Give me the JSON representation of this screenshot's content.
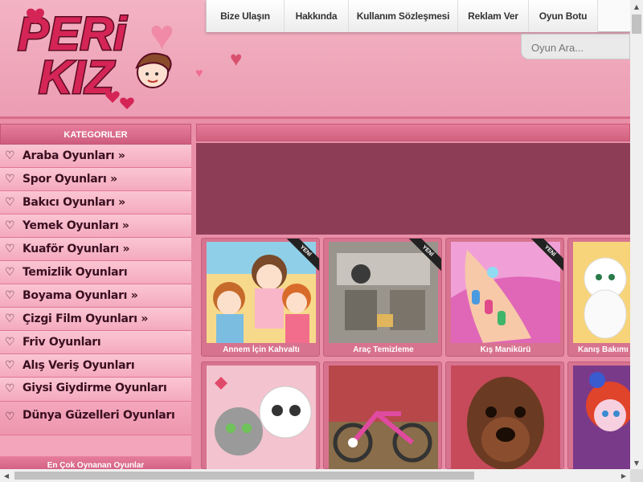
{
  "logo": {
    "line1": "PERi",
    "line2": "KIZ"
  },
  "nav": {
    "items": [
      "Bize Ulaşın",
      "Hakkında",
      "Kullanım Sözleşmesi",
      "Reklam Ver",
      "Oyun Botu"
    ]
  },
  "search": {
    "placeholder": "Oyun Ara..."
  },
  "sidebar": {
    "title": "KATEGORILER",
    "items": [
      {
        "label": "Araba Oyunları »"
      },
      {
        "label": "Spor Oyunları »"
      },
      {
        "label": "Bakıcı Oyunları »"
      },
      {
        "label": "Yemek Oyunları »"
      },
      {
        "label": "Kuaför Oyunları »"
      },
      {
        "label": "Temizlik Oyunları"
      },
      {
        "label": "Boyama Oyunları »"
      },
      {
        "label": "Çizgi Film Oyunları »"
      },
      {
        "label": "Friv Oyunları"
      },
      {
        "label": "Alış Veriş Oyunları"
      },
      {
        "label": "Giysi Giydirme Oyunları"
      },
      {
        "label": "Dünya Güzelleri Oyunları"
      }
    ],
    "footer": "En Çok Oynanan Oyunlar"
  },
  "games": [
    {
      "title": "Annem İçin Kahvaltı",
      "badge": "YENİ"
    },
    {
      "title": "Araç Temizleme",
      "badge": "YENİ"
    },
    {
      "title": "Kış Manikürü",
      "badge": "YENİ"
    },
    {
      "title": "Kanış Bakımı",
      "badge": ""
    },
    {
      "title": "",
      "badge": ""
    },
    {
      "title": "",
      "badge": ""
    },
    {
      "title": "",
      "badge": ""
    },
    {
      "title": "",
      "badge": ""
    }
  ],
  "colors": {
    "brand": "#d42556",
    "accent": "#e98fa7",
    "sidebar": "#f4a9bf"
  }
}
